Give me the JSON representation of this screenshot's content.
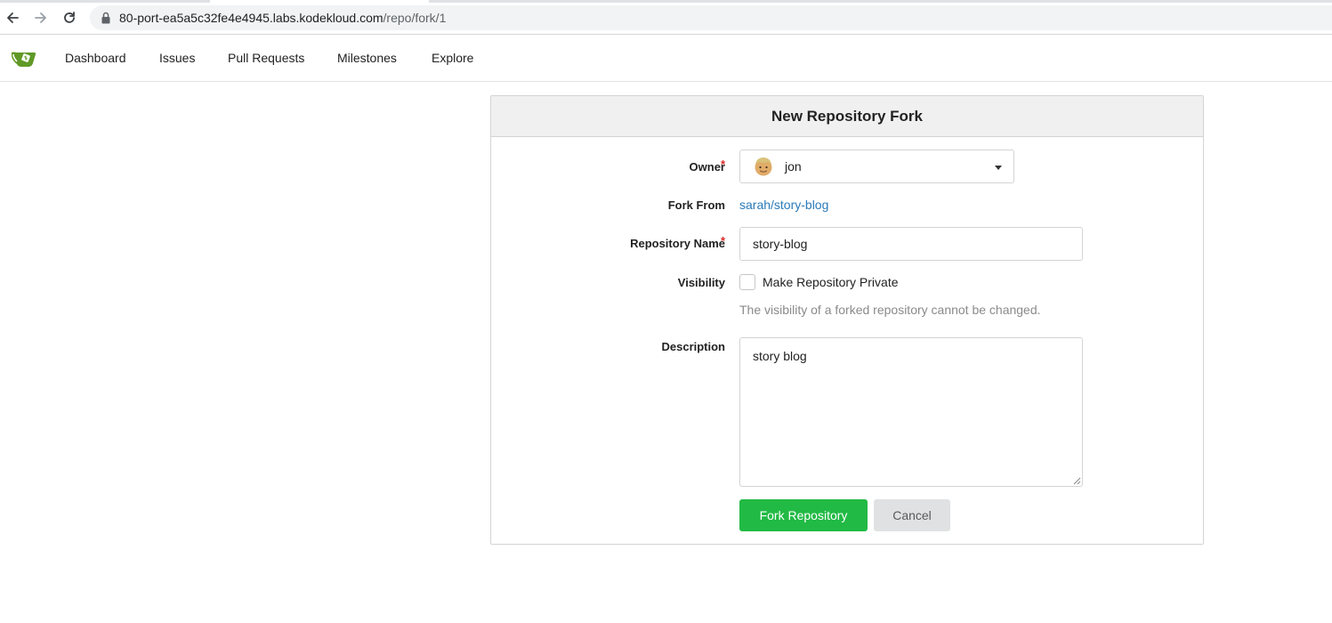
{
  "browser": {
    "url_host": "80-port-ea5a5c32fe4e4945.labs.kodekloud.com",
    "url_path": "/repo/fork/1"
  },
  "nav": {
    "items": [
      "Dashboard",
      "Issues",
      "Pull Requests",
      "Milestones",
      "Explore"
    ]
  },
  "form": {
    "title": "New Repository Fork",
    "owner_label": "Owner",
    "owner_value": "jon",
    "fork_from_label": "Fork From",
    "fork_from_value": "sarah/story-blog",
    "repo_name_label": "Repository Name",
    "repo_name_value": "story-blog",
    "visibility_label": "Visibility",
    "private_label": "Make Repository Private",
    "private_checked": false,
    "visibility_help": "The visibility of a forked repository cannot be changed.",
    "description_label": "Description",
    "description_value": "story blog",
    "required_marker": "*",
    "submit_label": "Fork Repository",
    "cancel_label": "Cancel"
  },
  "colors": {
    "primary": "#21ba45",
    "link": "#2a7ab8",
    "required": "#db2828",
    "logo": "#609926"
  },
  "icons": {
    "back": "arrow-left-icon",
    "forward": "arrow-right-icon",
    "reload": "reload-icon",
    "lock": "lock-icon",
    "logo": "gitea-teacup-icon",
    "dropdown": "caret-down-icon"
  }
}
